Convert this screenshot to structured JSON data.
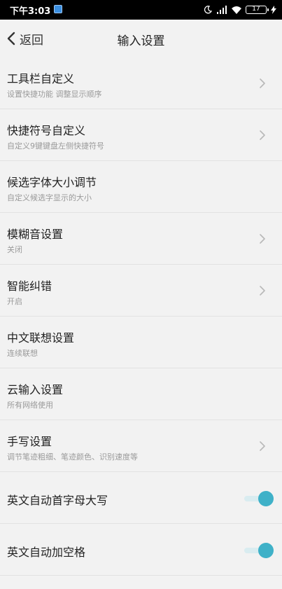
{
  "status": {
    "time": "下午3:03",
    "battery": "17"
  },
  "header": {
    "back_label": "返回",
    "title": "输入设置"
  },
  "settings": [
    {
      "label": "工具栏自定义",
      "sub": "设置快捷功能 调整显示顺序",
      "control": "chevron"
    },
    {
      "label": "快捷符号自定义",
      "sub": "自定义9键键盘左侧快捷符号",
      "control": "chevron"
    },
    {
      "label": "候选字体大小调节",
      "sub": "自定义候选字显示的大小",
      "control": "none"
    },
    {
      "label": "模糊音设置",
      "sub": "关闭",
      "control": "chevron"
    },
    {
      "label": "智能纠错",
      "sub": "开启",
      "control": "chevron"
    },
    {
      "label": "中文联想设置",
      "sub": "连续联想",
      "control": "none"
    },
    {
      "label": "云输入设置",
      "sub": "所有网络使用",
      "control": "none"
    },
    {
      "label": "手写设置",
      "sub": "调节笔迹粗细、笔迹颜色、识别速度等",
      "control": "chevron"
    },
    {
      "label": "英文自动首字母大写",
      "sub": "",
      "control": "toggle",
      "on": true
    },
    {
      "label": "英文自动加空格",
      "sub": "",
      "control": "toggle",
      "on": true
    }
  ],
  "colors": {
    "accent": "#3fb1c8",
    "background": "#f2f2f2"
  }
}
